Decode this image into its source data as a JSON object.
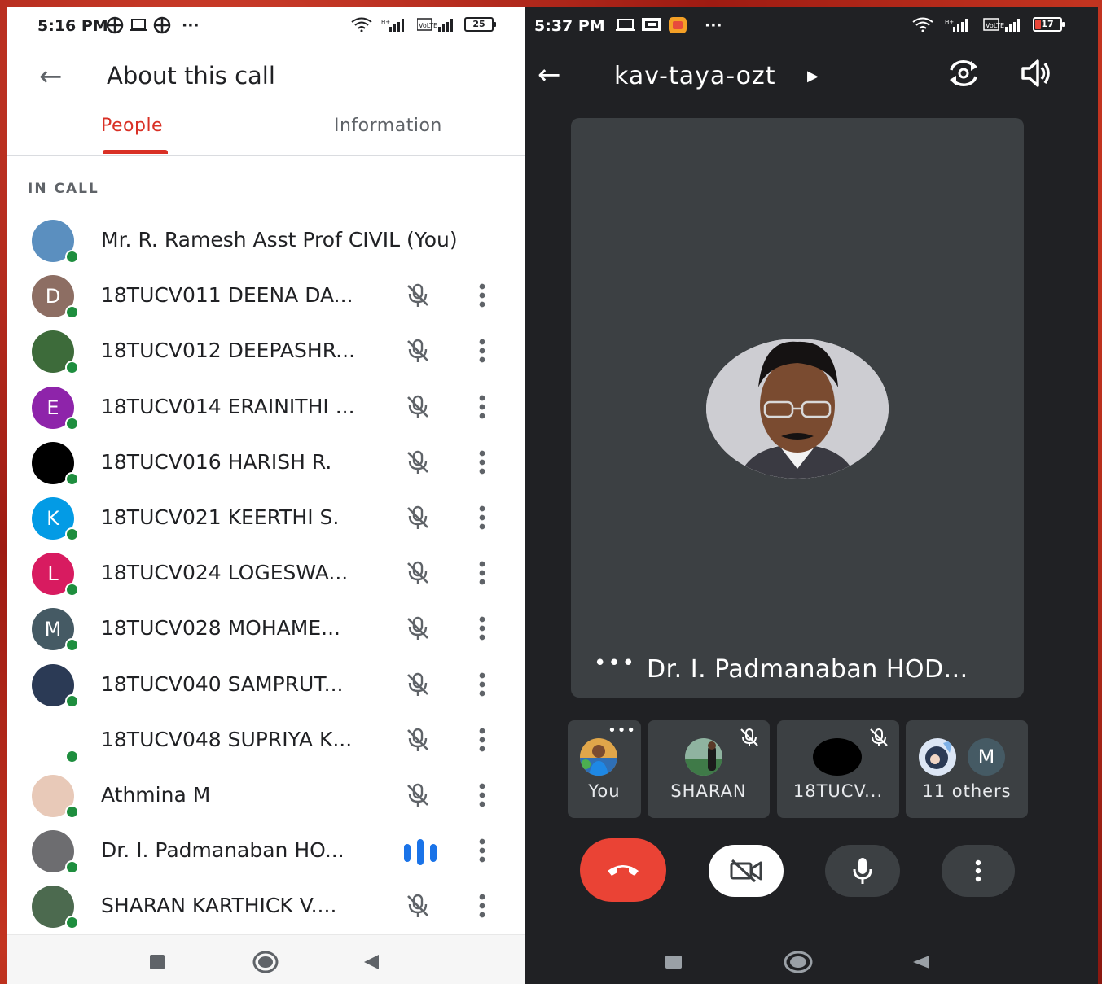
{
  "left_status": {
    "time": "5:16 PM",
    "ellipsis": "···",
    "battery": "25"
  },
  "left_header": {
    "title": "About this call"
  },
  "tabs": [
    {
      "label": "People"
    },
    {
      "label": "Information"
    }
  ],
  "section_label": "IN CALL",
  "participants": [
    {
      "name": "Mr. R. Ramesh Asst Prof CIVIL (You)",
      "initial": "",
      "color": "#5b8fbf",
      "status": "none"
    },
    {
      "name": "18TUCV011 DEENA DA...",
      "initial": "D",
      "color": "#8d6e63",
      "status": "muted"
    },
    {
      "name": "18TUCV012 DEEPASHR...",
      "initial": "",
      "color": "#3d6b3a",
      "status": "muted"
    },
    {
      "name": "18TUCV014 ERAINITHI ...",
      "initial": "E",
      "color": "#8e24aa",
      "status": "muted"
    },
    {
      "name": "18TUCV016 HARISH R.",
      "initial": "",
      "color": "#000000",
      "status": "muted"
    },
    {
      "name": "18TUCV021 KEERTHI S.",
      "initial": "K",
      "color": "#039be5",
      "status": "muted"
    },
    {
      "name": "18TUCV024 LOGESWA...",
      "initial": "L",
      "color": "#d81b60",
      "status": "muted"
    },
    {
      "name": "18TUCV028 MOHAME...",
      "initial": "M",
      "color": "#455a64",
      "status": "muted"
    },
    {
      "name": "18TUCV040 SAMPRUT...",
      "initial": "",
      "color": "#2b3a55",
      "status": "muted"
    },
    {
      "name": "18TUCV048 SUPRIYA K...",
      "initial": "",
      "color": "#ffffff",
      "status": "muted"
    },
    {
      "name": "Athmina M",
      "initial": "",
      "color": "#e8c9b8",
      "status": "muted"
    },
    {
      "name": "Dr. I. Padmanaban HO...",
      "initial": "",
      "color": "#6d6d70",
      "status": "speaking"
    },
    {
      "name": "SHARAN KARTHICK V....",
      "initial": "",
      "color": "#4c6a4f",
      "status": "muted"
    }
  ],
  "right_status": {
    "time": "5:37 PM",
    "ellipsis": "···",
    "battery": "17"
  },
  "right_header": {
    "meeting_code": "kav-taya-ozt"
  },
  "stage": {
    "name": "Dr. I. Padmanaban HOD..."
  },
  "thumbnails": [
    {
      "label": "You"
    },
    {
      "label": "SHARAN"
    },
    {
      "label": "18TUCV..."
    },
    {
      "label": "11 others",
      "initial": "M"
    }
  ],
  "colors": {
    "accent_red": "#d93025",
    "end_call": "#ea4335",
    "speaking_blue": "#1a73e8",
    "online_green": "#1e8e3e",
    "dark_bg": "#202124",
    "tile_bg": "#3c4043"
  }
}
